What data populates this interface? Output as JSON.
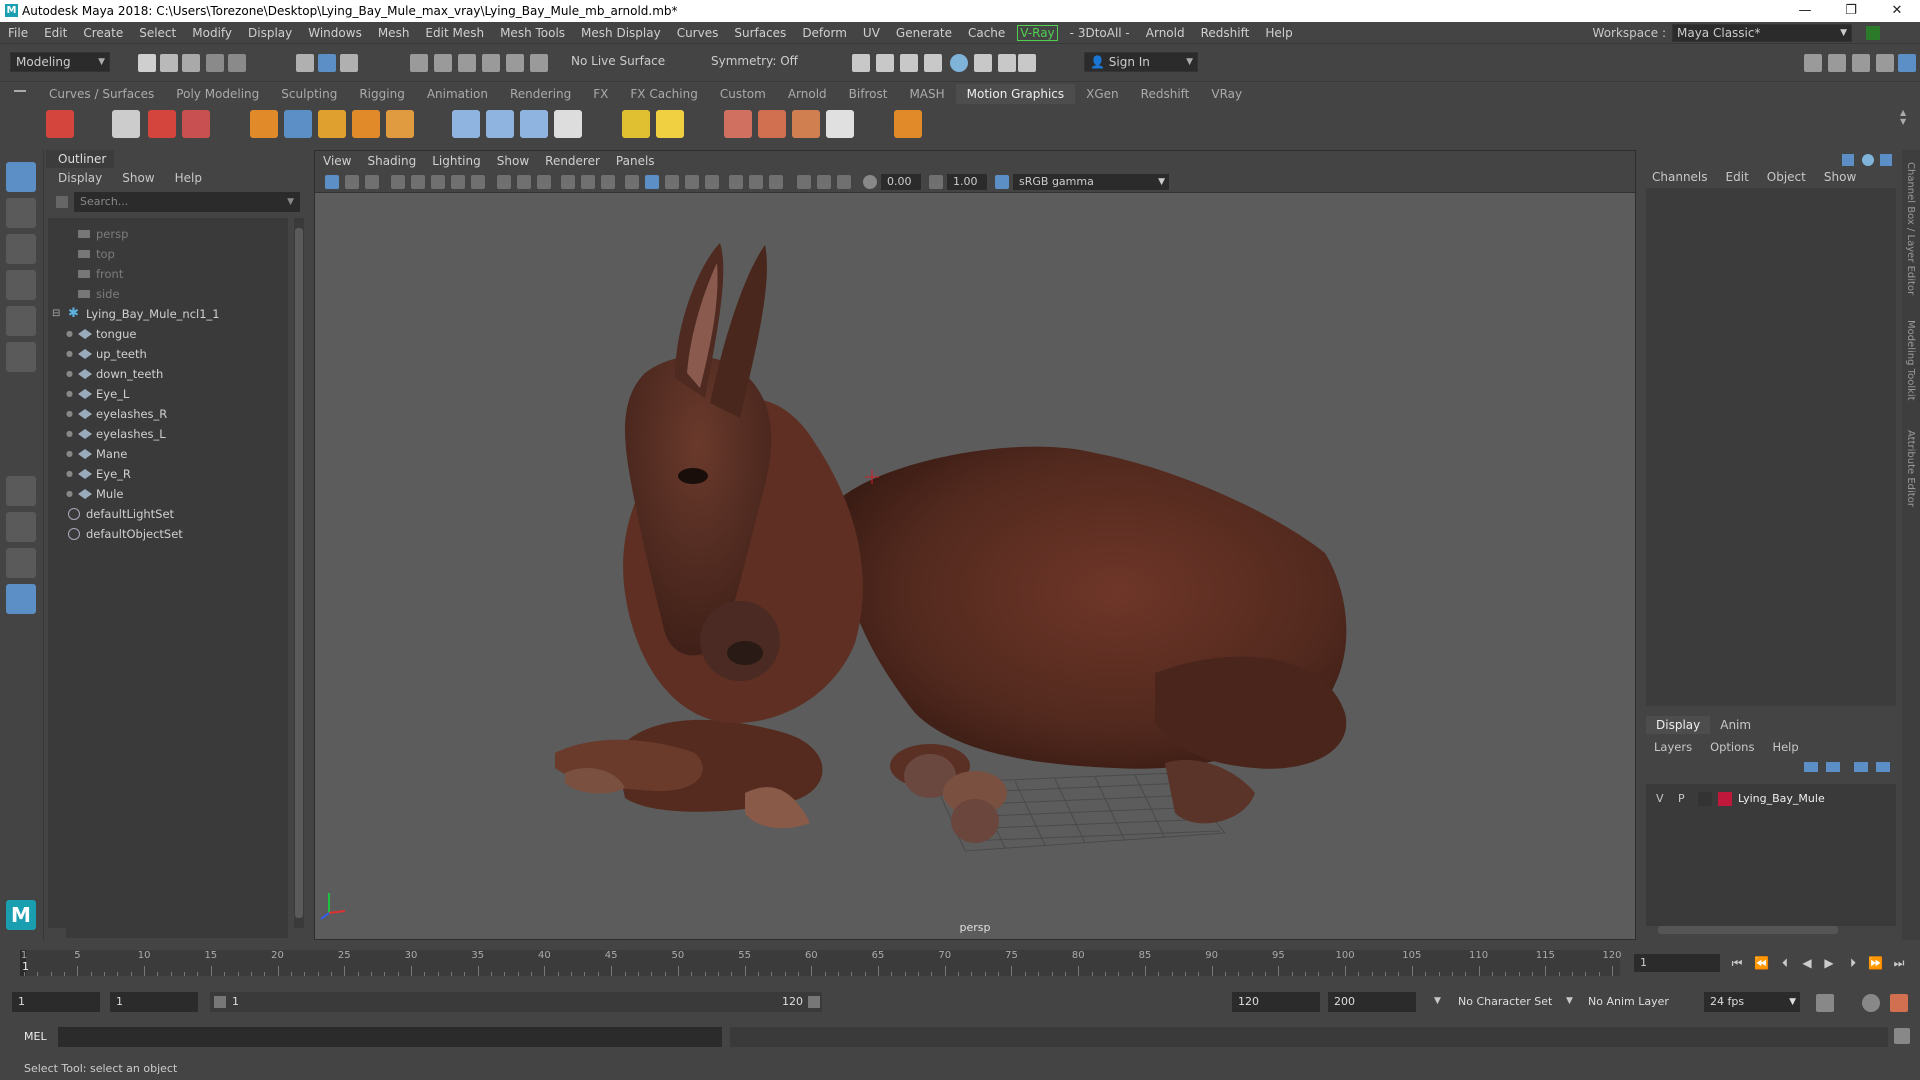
{
  "window": {
    "title": "Autodesk Maya 2018: C:\\Users\\Torezone\\Desktop\\Lying_Bay_Mule_max_vray\\Lying_Bay_Mule_mb_arnold.mb*",
    "minimize": "—",
    "restore": "❐",
    "close": "✕"
  },
  "menubar": {
    "items": [
      "File",
      "Edit",
      "Create",
      "Select",
      "Modify",
      "Display",
      "Windows",
      "Mesh",
      "Edit Mesh",
      "Mesh Tools",
      "Mesh Display",
      "Curves",
      "Surfaces",
      "Deform",
      "UV",
      "Generate",
      "Cache"
    ],
    "vray": "V-Ray",
    "items2": [
      "- 3DtoAll -",
      "Arnold",
      "Redshift",
      "Help"
    ],
    "workspace_label": "Workspace :",
    "workspace_value": "Maya Classic*"
  },
  "statusline": {
    "mode": "Modeling",
    "live_surface": "No Live Surface",
    "symmetry": "Symmetry: Off",
    "sign_in": "Sign In"
  },
  "shelf_tabs": [
    "Curves / Surfaces",
    "Poly Modeling",
    "Sculpting",
    "Rigging",
    "Animation",
    "Rendering",
    "FX",
    "FX Caching",
    "Custom",
    "Arnold",
    "Bifrost",
    "MASH",
    "Motion Graphics",
    "XGen",
    "Redshift",
    "VRay"
  ],
  "shelf_active": "Motion Graphics",
  "outliner": {
    "title": "Outliner",
    "menu": [
      "Display",
      "Show",
      "Help"
    ],
    "search_placeholder": "Search...",
    "cameras": [
      "persp",
      "top",
      "front",
      "side"
    ],
    "root": "Lying_Bay_Mule_ncl1_1",
    "children": [
      "tongue",
      "up_teeth",
      "down_teeth",
      "Eye_L",
      "eyelashes_R",
      "eyelashes_L",
      "Mane",
      "Eye_R",
      "Mule"
    ],
    "sets": [
      "defaultLightSet",
      "defaultObjectSet"
    ]
  },
  "viewport": {
    "menu": [
      "View",
      "Shading",
      "Lighting",
      "Show",
      "Renderer",
      "Panels"
    ],
    "exposure": "0.00",
    "gamma": "1.00",
    "color_space": "sRGB gamma",
    "camera": "persp"
  },
  "channelbox": {
    "menu": [
      "Channels",
      "Edit",
      "Object",
      "Show"
    ],
    "tabs": [
      "Display",
      "Anim"
    ],
    "layer_menu": [
      "Layers",
      "Options",
      "Help"
    ],
    "layer": {
      "v": "V",
      "p": "P",
      "name": "Lying_Bay_Mule",
      "color": "#c0183a"
    },
    "side_tabs": [
      "Channel Box / Layer Editor",
      "Modeling Toolkit",
      "Attribute Editor"
    ]
  },
  "timeline": {
    "ticks": [
      1,
      5,
      10,
      15,
      20,
      25,
      30,
      35,
      40,
      45,
      50,
      55,
      60,
      65,
      70,
      75,
      80,
      85,
      90,
      95,
      100,
      105,
      110,
      115,
      120
    ],
    "current_frame": "1",
    "current_frame_marker": "1"
  },
  "range": {
    "start": "1",
    "playback_start": "1",
    "slider_start": "1",
    "slider_end": "120",
    "playback_end": "120",
    "end": "200",
    "character_set": "No Character Set",
    "anim_layer": "No Anim Layer",
    "fps": "24 fps"
  },
  "command": {
    "label": "MEL"
  },
  "help": {
    "text": "Select Tool: select an object"
  },
  "colors": {
    "accent": "#5d8fc7",
    "bg": "#444444",
    "viewport": "#5c5c5c",
    "mule_body": "#5a2e22"
  }
}
